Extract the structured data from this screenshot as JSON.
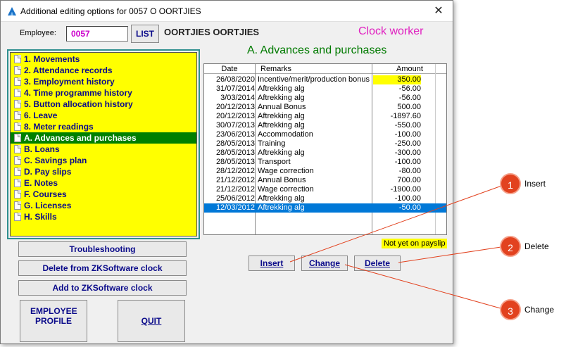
{
  "window": {
    "title": "Additional editing options for 0057 O OORTJIES",
    "close_glyph": "✕"
  },
  "employee": {
    "label": "Employee:",
    "code": "0057",
    "list_label": "LIST",
    "name": "OORTJIES OORTJIES",
    "type": "Clock worker"
  },
  "section_title": "A. Advances and purchases",
  "menu": {
    "items": [
      {
        "label": "1. Movements"
      },
      {
        "label": "2. Attendance records"
      },
      {
        "label": "3. Employment history"
      },
      {
        "label": "4. Time programme history"
      },
      {
        "label": "5. Button allocation history"
      },
      {
        "label": "6. Leave"
      },
      {
        "label": "8. Meter readings"
      },
      {
        "label": "A. Advances and purchases"
      },
      {
        "label": "B. Loans"
      },
      {
        "label": "C. Savings plan"
      },
      {
        "label": "D. Pay slips"
      },
      {
        "label": "E. Notes"
      },
      {
        "label": "F. Courses"
      },
      {
        "label": "G. Licenses"
      },
      {
        "label": "H. Skills"
      }
    ],
    "selected_index": 7
  },
  "left_buttons": {
    "troubleshooting": "Troubleshooting",
    "delete_zk": "Delete from ZKSoftware clock",
    "add_zk": "Add to ZKSoftware clock",
    "employee_profile": "EMPLOYEE PROFILE",
    "quit": "QUIT"
  },
  "table": {
    "headers": {
      "date": "Date",
      "remarks": "Remarks",
      "amount": "Amount"
    },
    "rows": [
      {
        "date": "26/08/2020",
        "remarks": "Incentive/merit/production bonus",
        "amount": "350.00"
      },
      {
        "date": "31/07/2014",
        "remarks": "Aftrekking alg",
        "amount": "-56.00"
      },
      {
        "date": "3/03/2014",
        "remarks": "Aftrekking alg",
        "amount": "-56.00"
      },
      {
        "date": "20/12/2013",
        "remarks": "Annual Bonus",
        "amount": "500.00"
      },
      {
        "date": "20/12/2013",
        "remarks": "Aftrekking alg",
        "amount": "-1897.60"
      },
      {
        "date": "30/07/2013",
        "remarks": "Aftrekking alg",
        "amount": "-550.00"
      },
      {
        "date": "23/06/2013",
        "remarks": "Accommodation",
        "amount": "-100.00"
      },
      {
        "date": "28/05/2013",
        "remarks": "Training",
        "amount": "-250.00"
      },
      {
        "date": "28/05/2013",
        "remarks": "Aftrekking alg",
        "amount": "-300.00"
      },
      {
        "date": "28/05/2013",
        "remarks": "Transport",
        "amount": "-100.00"
      },
      {
        "date": "28/12/2012",
        "remarks": "Wage correction",
        "amount": "-80.00"
      },
      {
        "date": "21/12/2012",
        "remarks": "Annual Bonus",
        "amount": "700.00"
      },
      {
        "date": "21/12/2012",
        "remarks": "Wage correction",
        "amount": "-1900.00"
      },
      {
        "date": "25/06/2012",
        "remarks": "Aftrekking alg",
        "amount": "-100.00"
      },
      {
        "date": "12/03/2012",
        "remarks": "Aftrekking alg",
        "amount": "-50.00"
      }
    ],
    "highlighted_row": 0,
    "selected_row": 14
  },
  "legend": {
    "not_on_payslip": "Not yet on payslip"
  },
  "actions": {
    "insert": "Insert",
    "change": "Change",
    "delete": "Delete"
  },
  "callouts": [
    {
      "number": "1",
      "label": "Insert"
    },
    {
      "number": "2",
      "label": "Delete"
    },
    {
      "number": "3",
      "label": "Change"
    }
  ],
  "colors": {
    "menu_bg": "#ffff00",
    "menu_selected": "#008000",
    "label_text": "#0a0a8a",
    "clock_worker": "#e020c0",
    "section_title": "#007a00",
    "row_selected": "#0078d7",
    "callout": "#e2421f"
  }
}
